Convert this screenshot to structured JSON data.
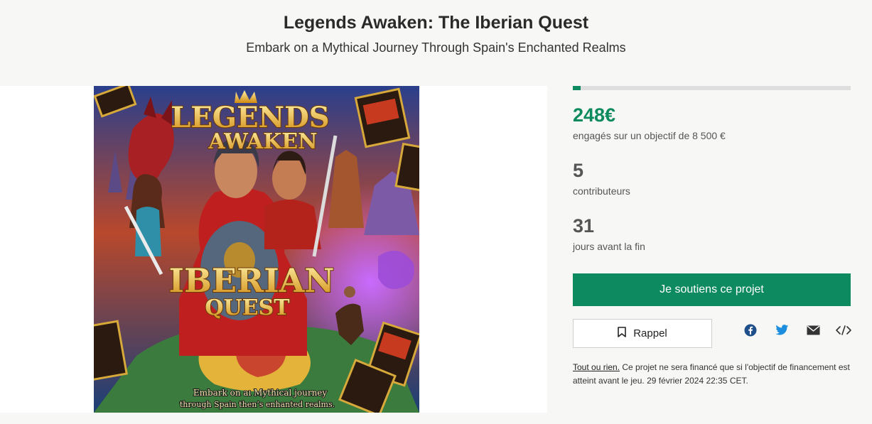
{
  "header": {
    "title": "Legends Awaken: The Iberian Quest",
    "subtitle": "Embark on a Mythical Journey Through Spain's Enchanted Realms"
  },
  "cover": {
    "title_line1": "LEGENDS",
    "title_line2": "AWAKEN",
    "title_line3": "IBERIAN",
    "title_line4": "QUEST",
    "tagline_line1": "Embark on aı Mythical journey",
    "tagline_line2": "through Spain then’s enhanted realms."
  },
  "funding": {
    "progress_fraction": 0.029,
    "amount": "248€",
    "amount_label": "engagés sur un objectif de 8 500 €",
    "contributors": "5",
    "contributors_label": "contributeurs",
    "days": "31",
    "days_label": "jours avant la fin"
  },
  "actions": {
    "support_label": "Je soutiens ce projet",
    "remind_label": "Rappel",
    "share_icons": [
      "facebook-icon",
      "twitter-icon",
      "email-icon",
      "embed-icon"
    ]
  },
  "note": {
    "link": "Tout ou rien.",
    "text": " Ce projet ne sera financé que si l'objectif de financement est atteint avant le jeu. 29 février 2024 22:35 CET."
  },
  "colors": {
    "accent": "#0d8a5f",
    "background": "#f7f7f5"
  }
}
